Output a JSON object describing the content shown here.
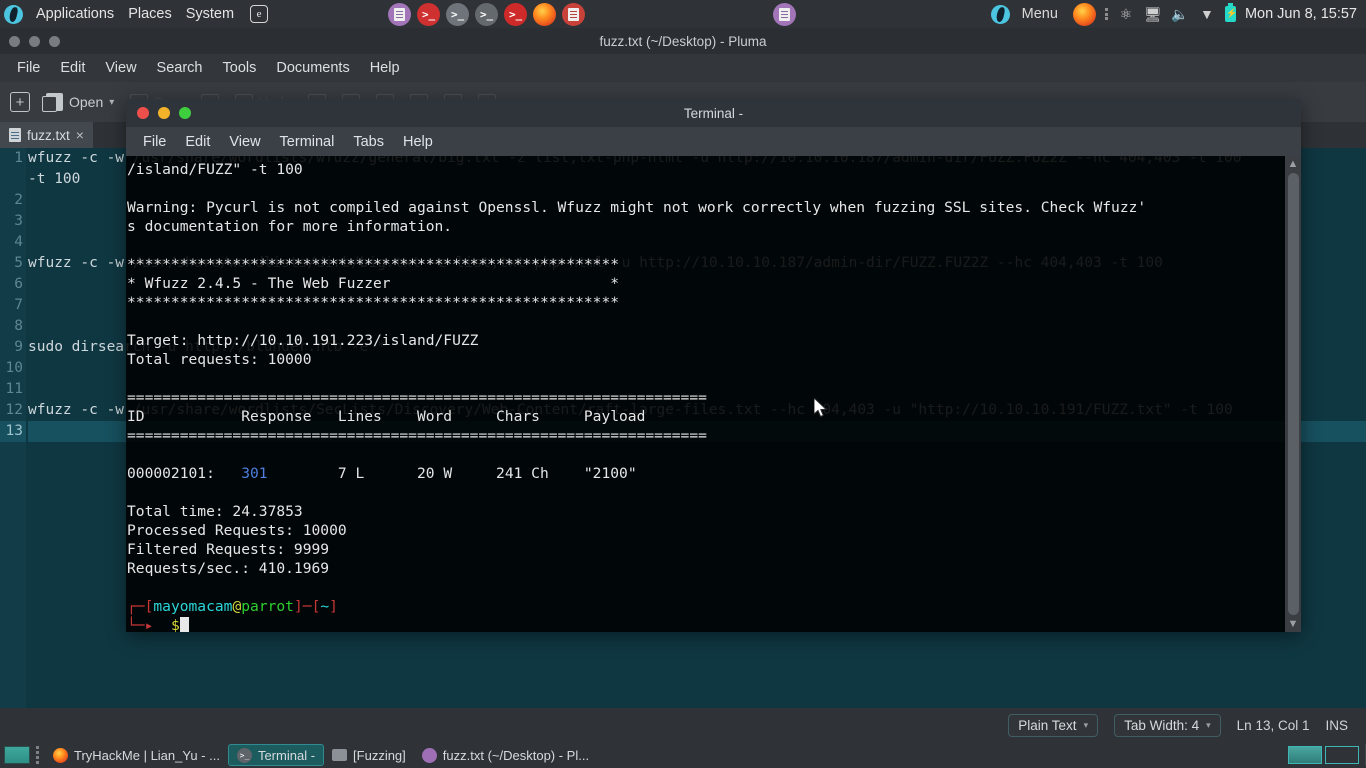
{
  "top_panel": {
    "menus": [
      "Applications",
      "Places",
      "System"
    ],
    "boxed_icon_label": "e",
    "boxed_icon_name": "anonsurf-icon",
    "launchers": [
      {
        "name": "text-editor-launcher",
        "glyph": ""
      },
      {
        "name": "terminal-red-launcher",
        "glyph": ">_"
      },
      {
        "name": "terminal-gray-launcher",
        "glyph": ">_"
      },
      {
        "name": "terminal-multi-launcher",
        "glyph": ">_"
      },
      {
        "name": "terminal-root-launcher",
        "glyph": ">_"
      },
      {
        "name": "firefox-launcher",
        "glyph": ""
      },
      {
        "name": "notes-launcher",
        "glyph": ""
      }
    ],
    "center_icon_name": "text-editor-indicator",
    "menu_label": "Menu",
    "tray": [
      "firefox-tray-icon",
      "dots-menu-icon",
      "bluetooth-icon",
      "display-icon",
      "volume-icon",
      "wifi-icon",
      "battery-icon"
    ],
    "clock": "Mon Jun 8, 15:57"
  },
  "pluma": {
    "title": "fuzz.txt (~/Desktop) - Pluma",
    "menus": [
      "File",
      "Edit",
      "View",
      "Search",
      "Tools",
      "Documents",
      "Help"
    ],
    "toolbar": {
      "new_label": "",
      "open_label": "Open",
      "save_label": "Save",
      "print_label": "Print",
      "undo_label": "Undo",
      "redo_label": "Redo"
    },
    "tab": {
      "label": "fuzz.txt",
      "close_label": "×"
    },
    "line_numbers": [
      "1",
      "2",
      "3",
      "4",
      "5",
      "6",
      "7",
      "8",
      "9",
      "10",
      "11",
      "12",
      "13"
    ],
    "current_line": 13,
    "lines": [
      "wfuzz -c -w /usr/share/wordlists/wfuzz/general/big.txt -z list,txt-php-html -u http://10.10.10.187/admin-dir/FUZZ.FUZ2Z --hc 404,403 -t 100",
      "",
      "",
      "",
      "wfuzz -c -w /usr/share/wordlists/dirb/big.txt -z list,txt-php-html -u http://10.10.10.187/admin-dir/FUZZ.FUZ2Z --hc 404,403 -t 100",
      "",
      "",
      "",
      "sudo dirsearch -u http://blunder.htb -e *",
      "",
      "",
      "wfuzz -c -w /usr/share/wordlists/SecLists/Discovery/Web-Content/raft-large-files.txt --hc 404,403 -u \"http://10.10.10.191/FUZZ.txt\" -t 100",
      ""
    ],
    "line1_wrap": "-t 100",
    "statusbar": {
      "language": "Plain Text",
      "tab_width": "Tab Width:  4",
      "position": "Ln 13, Col 1",
      "insert_mode": "INS"
    }
  },
  "terminal": {
    "title": "Terminal -",
    "menus": [
      "File",
      "Edit",
      "View",
      "Terminal",
      "Tabs",
      "Help"
    ],
    "lines": [
      "/island/FUZZ\" -t 100",
      "",
      "Warning: Pycurl is not compiled against Openssl. Wfuzz might not work correctly when fuzzing SSL sites. Check Wfuzz'",
      "s documentation for more information.",
      "",
      "********************************************************",
      "* Wfuzz 2.4.5 - The Web Fuzzer                         *",
      "********************************************************",
      "",
      "Target: http://10.10.191.223/island/FUZZ",
      "Total requests: 10000",
      "",
      "==================================================================",
      "ID           Response   Lines    Word     Chars     Payload",
      "==================================================================",
      "",
      "000002101:   301        7 L      20 W     241 Ch    \"2100\"",
      "",
      "Total time: 24.37853",
      "Processed Requests: 10000",
      "Filtered Requests: 9999",
      "Requests/sec.: 410.1969",
      ""
    ],
    "result_row": {
      "id": "000002101:",
      "response": "301",
      "lines": "7 L",
      "word": "20 W",
      "chars": "241 Ch",
      "payload": "\"2100\""
    },
    "prompt": {
      "user": "mayomacam",
      "at": "@",
      "host": "parrot",
      "path": "~",
      "symbol": "$"
    }
  },
  "taskbar": {
    "items": [
      {
        "label": "TryHackMe | Lian_Yu - ...",
        "icon": "firefox-icon",
        "active": false
      },
      {
        "label": "Terminal -",
        "icon": "terminal-icon",
        "active": true
      },
      {
        "label": "[Fuzzing]",
        "icon": "folder-icon",
        "active": false
      },
      {
        "label": "fuzz.txt (~/Desktop) - Pl...",
        "icon": "pluma-icon",
        "active": false
      }
    ],
    "workspaces": [
      {
        "name": "workspace-1",
        "active": true
      },
      {
        "name": "workspace-2",
        "active": false
      }
    ]
  }
}
